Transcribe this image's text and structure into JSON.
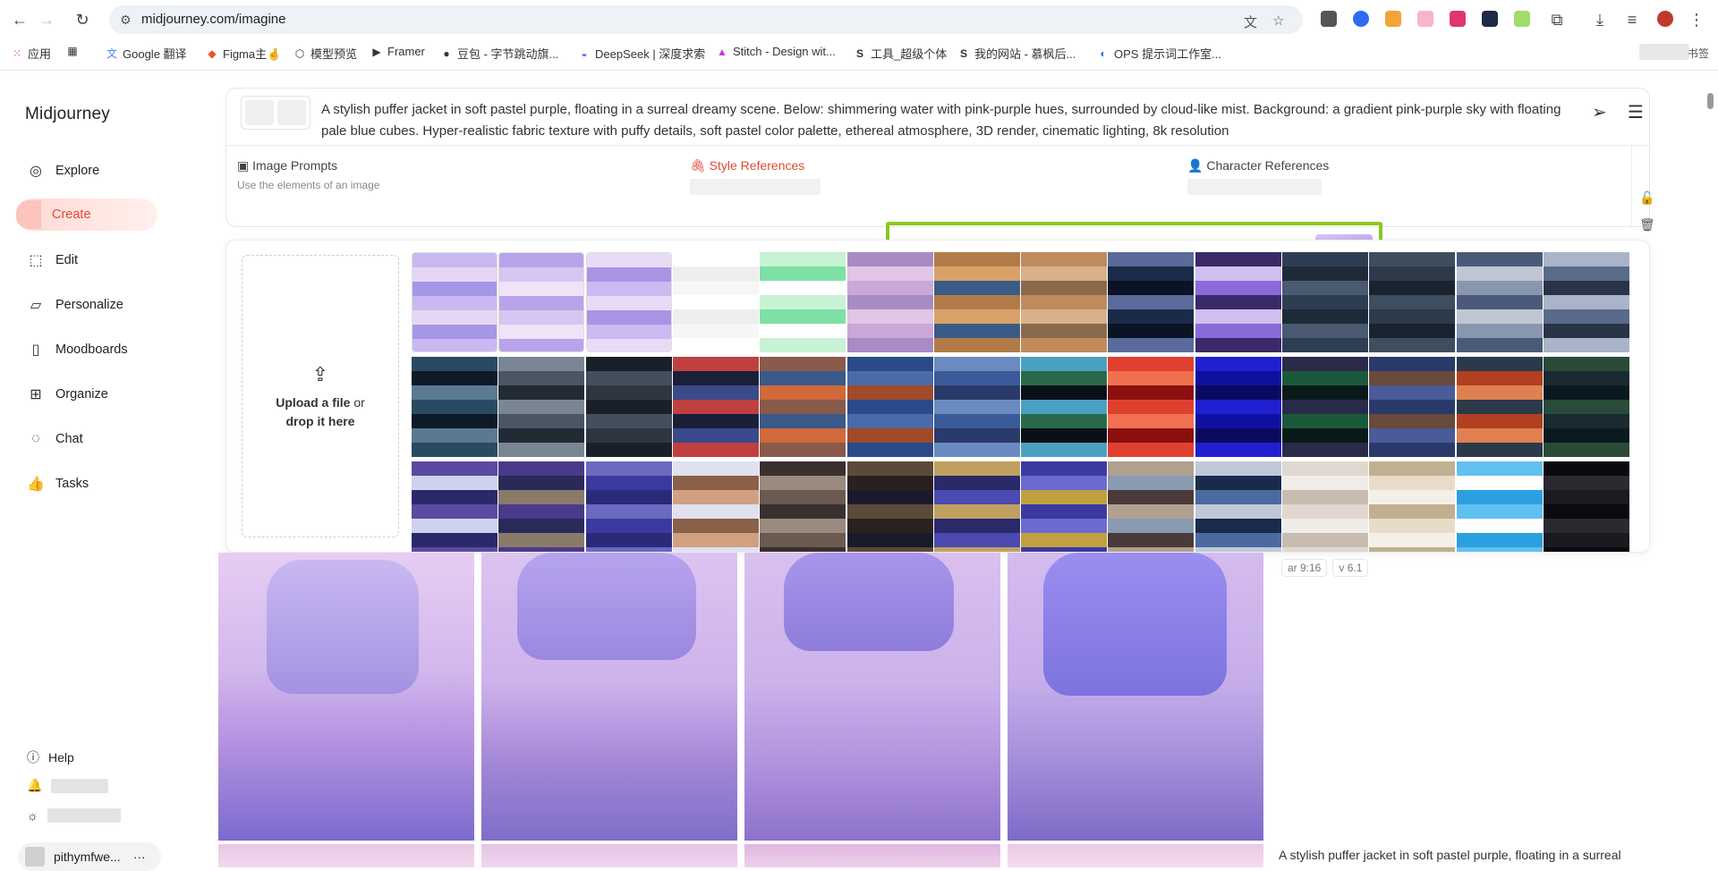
{
  "browser": {
    "url": "midjourney.com/imagine",
    "bookmarks": [
      {
        "label": "应用",
        "icon": "apps-grid-icon"
      },
      {
        "label": "",
        "icon": "grid-icon"
      },
      {
        "label": "Google 翻译",
        "icon": "translate-icon"
      },
      {
        "label": "Figma主🤞",
        "icon": "figma-icon"
      },
      {
        "label": "模型预览",
        "icon": "cube-icon"
      },
      {
        "label": "Framer",
        "icon": "framer-icon"
      },
      {
        "label": "豆包 - 字节跳动旗...",
        "icon": "doubao-icon"
      },
      {
        "label": "DeepSeek | 深度求索",
        "icon": "deepseek-icon"
      },
      {
        "label": "Stitch - Design wit...",
        "icon": "stitch-icon"
      },
      {
        "label": "工具_超级个体",
        "icon": "s-logo-icon"
      },
      {
        "label": "我的网站 - 慕枫后...",
        "icon": "s-logo-icon"
      },
      {
        "label": "OPS 提示词工作室...",
        "icon": "ops-icon"
      }
    ],
    "bookmark_overflow": "书签"
  },
  "sidebar": {
    "logo": "Midjourney",
    "items": [
      {
        "label": "Explore",
        "icon": "compass-icon"
      },
      {
        "label": "Create",
        "icon": "create-icon",
        "active": true
      },
      {
        "label": "Edit",
        "icon": "edit-icon"
      },
      {
        "label": "Personalize",
        "icon": "personalize-icon"
      },
      {
        "label": "Moodboards",
        "icon": "moodboard-icon"
      },
      {
        "label": "Organize",
        "icon": "organize-icon"
      },
      {
        "label": "Chat",
        "icon": "chat-icon"
      },
      {
        "label": "Tasks",
        "icon": "thumbs-up-icon"
      }
    ],
    "help": "Help",
    "username": "pithymfwe..."
  },
  "prompt": {
    "text": "A stylish puffer jacket in soft pastel purple, floating in a surreal dreamy scene. Below: shimmering water with pink-purple hues, surrounded by cloud-like mist. Background: a gradient pink-purple sky with floating pale blue cubes. Hyper-realistic fabric texture with puffy details, soft pastel color palette, ethereal atmosphere, 3D render, cinematic lighting, 8k resolution"
  },
  "references": {
    "image_prompts": {
      "label": "Image Prompts",
      "sub": "Use the elements of an image"
    },
    "style_references": {
      "label": "Style References"
    },
    "character_references": {
      "label": "Character References"
    }
  },
  "upload": {
    "line1": "Upload a file",
    "line1_suffix": " or",
    "line2": "drop it here"
  },
  "job": {
    "tags": [
      "ar 9:16",
      "v 6.1"
    ],
    "caption": "A stylish puffer jacket in soft pastel purple, floating in a surreal"
  },
  "colors": {
    "accent": "#e24a36",
    "highlight": "#8bc81e"
  }
}
